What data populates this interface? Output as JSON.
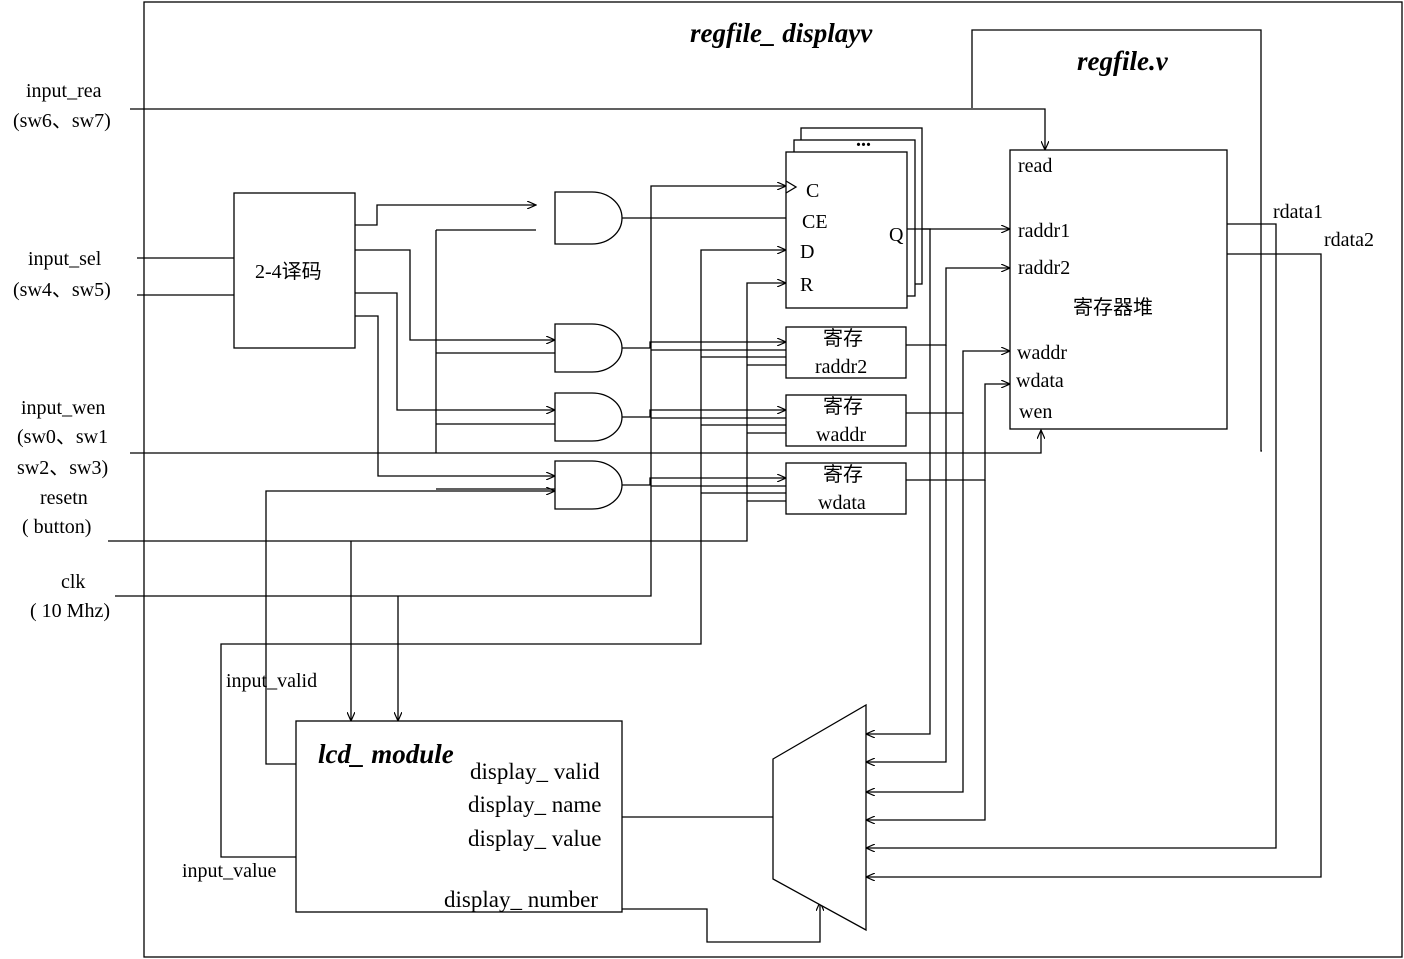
{
  "titles": {
    "top_module": "regfile_ displayv",
    "regfile_module": "regfile.v",
    "lcd_module": "lcd_ module"
  },
  "inputs": {
    "input_rea": "input_rea",
    "input_rea_sw": "(sw6、sw7)",
    "input_sel": "input_sel",
    "input_sel_sw": "(sw4、sw5)",
    "input_wen": "input_wen",
    "input_wen_sw1": "(sw0、sw1",
    "input_wen_sw2": "sw2、sw3)",
    "resetn": "resetn",
    "resetn_sub": "( button)",
    "clk": "clk",
    "clk_sub": "( 10 Mhz)"
  },
  "decoder": {
    "label": "2-4译码"
  },
  "ff": {
    "c": "C",
    "ce": "CE",
    "d": "D",
    "r": "R",
    "q": "Q",
    "dots": "..."
  },
  "regs": [
    {
      "top": "寄存",
      "bottom": "raddr2"
    },
    {
      "top": "寄存",
      "bottom": "waddr"
    },
    {
      "top": "寄存",
      "bottom": "wdata"
    }
  ],
  "regfile": {
    "read": "read",
    "raddr1": "raddr1",
    "raddr2": "raddr2",
    "center": "寄存器堆",
    "waddr": "waddr",
    "wdata": "wdata",
    "wen": "wen",
    "rdata1": "rdata1",
    "rdata2": "rdata2"
  },
  "lcd": {
    "input_valid": "input_valid",
    "input_value": "input_value",
    "display_valid": "display_ valid",
    "display_name": "display_ name",
    "display_value": "display_ value",
    "display_number": "display_ number"
  }
}
